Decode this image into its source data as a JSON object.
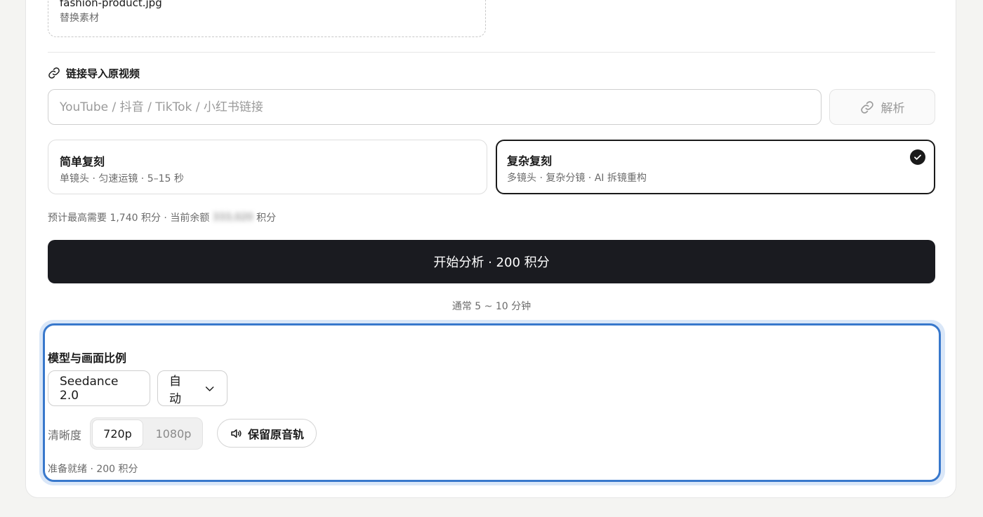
{
  "upload": {
    "filename": "fashion-product.jpg",
    "replace_label": "替换素材"
  },
  "link_import": {
    "label": "链接导入原视频",
    "icon": "link-icon",
    "input_value": "",
    "input_placeholder": "YouTube / 抖音 / TikTok / 小红书链接",
    "parse_label": "解析"
  },
  "modes": [
    {
      "title": "简单复刻",
      "desc": "单镜头 · 匀速运镜 · 5–15 秒",
      "selected": false
    },
    {
      "title": "复杂复刻",
      "desc": "多镜头 · 复杂分镜 · AI 拆镜重构",
      "selected": true
    }
  ],
  "estimate": {
    "prefix": "预计最高需要 1,740 积分 · 当前余额 ",
    "balance_blurred": "333,020",
    "suffix": " 积分"
  },
  "start_button": {
    "label": "开始分析 · 200 积分"
  },
  "duration_note": "通常 5 ~ 10 分钟",
  "model_panel": {
    "title": "模型与画面比例",
    "model_value": "Seedance 2.0",
    "ratio_value": "自动",
    "resolution_label": "清晰度",
    "resolution_options": [
      "720p",
      "1080p"
    ],
    "resolution_selected": "720p",
    "audio_label": "保留原音轨",
    "status": "准备就绪 · 200 积分"
  },
  "colors": {
    "accent_focus": "#3878cc",
    "primary_button": "#1a1b20",
    "page_background": "#f4f4f2"
  }
}
